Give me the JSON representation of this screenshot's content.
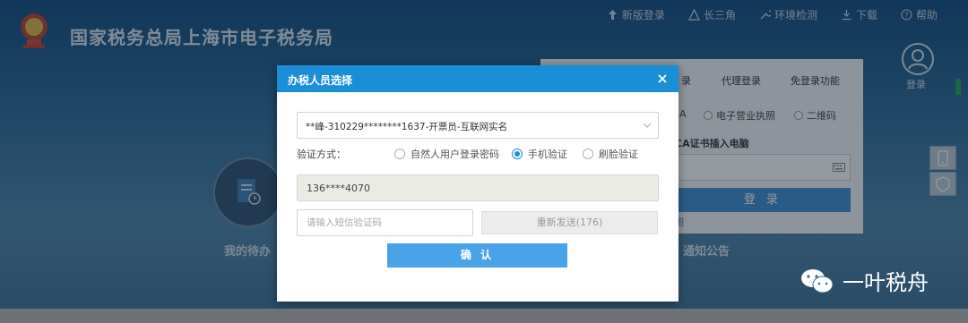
{
  "site": {
    "title": "国家税务总局上海市电子税务局"
  },
  "topnav": {
    "items": [
      {
        "label": "新版登录",
        "icon": "arrow-up-icon"
      },
      {
        "label": "长三角",
        "icon": "triangle-icon"
      },
      {
        "label": "环境检测",
        "icon": "wrench-icon"
      },
      {
        "label": "下载",
        "icon": "download-icon"
      },
      {
        "label": "帮助",
        "icon": "help-icon"
      }
    ]
  },
  "login_panel": {
    "tabs": [
      "录",
      "代理登录",
      "免登录功能"
    ],
    "radio_options": [
      "A",
      "电子营业执照",
      "二维码"
    ],
    "ca_text": "CA证书插入电脑",
    "login_button": "登 录",
    "small_link": "图"
  },
  "user": {
    "login_label": "登录"
  },
  "background_labels": {
    "todo": "我的待办",
    "notice": "通知公告"
  },
  "watermark": {
    "text": "一叶税舟"
  },
  "modal": {
    "title": "办税人员选择",
    "person_value": "**峰-310229********1637-开票员-互联网实名",
    "verify_label": "验证方式：",
    "verify_options": [
      {
        "label": "自然人用户登录密码",
        "checked": false
      },
      {
        "label": "手机验证",
        "checked": true
      },
      {
        "label": "刷脸验证",
        "checked": false
      }
    ],
    "phone": "136****4070",
    "code_placeholder": "请输入短信验证码",
    "resend_label": "重新发送(176)",
    "confirm_label": "确 认"
  },
  "colors": {
    "header_blue": "#1a8fd8",
    "confirm_blue": "#4aa3e8",
    "radio_checked": "#1a8fd8"
  }
}
